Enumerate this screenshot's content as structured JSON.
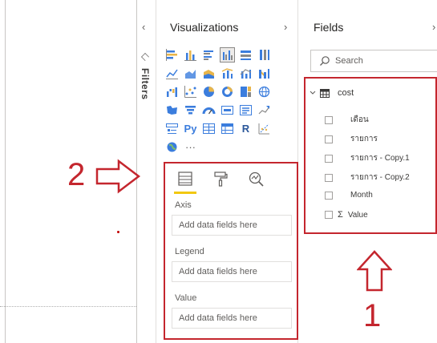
{
  "filters": {
    "label": "Filters"
  },
  "visualizations": {
    "title": "Visualizations",
    "visual_icons": [
      "stacked-bar-icon",
      "stacked-column-icon",
      "clustered-bar-icon",
      "clustered-column-icon",
      "100-stacked-bar-icon",
      "100-stacked-column-icon",
      "line-chart-icon",
      "area-chart-icon",
      "stacked-area-icon",
      "line-clustered-column-icon",
      "line-stacked-column-icon",
      "ribbon-chart-icon",
      "waterfall-icon",
      "scatter-icon",
      "pie-chart-icon",
      "donut-chart-icon",
      "treemap-icon",
      "map-icon",
      "filled-map-icon",
      "funnel-icon",
      "gauge-icon",
      "card-icon",
      "multi-row-card-icon",
      "kpi-icon",
      "slicer-icon",
      "python-visual-icon",
      "table-icon",
      "matrix-icon",
      "r-visual-icon",
      "key-influencers-icon",
      "globe-icon",
      "more-visuals-icon"
    ],
    "python_label": "Py",
    "r_label": "R",
    "more_label": "···",
    "wells": [
      {
        "label": "Axis",
        "placeholder": "Add data fields here"
      },
      {
        "label": "Legend",
        "placeholder": "Add data fields here"
      },
      {
        "label": "Value",
        "placeholder": "Add data fields here"
      }
    ]
  },
  "fields": {
    "title": "Fields",
    "search_placeholder": "Search",
    "table_name": "cost",
    "items": [
      {
        "label": "เดือน",
        "sigma": false
      },
      {
        "label": "รายการ",
        "sigma": false
      },
      {
        "label": "รายการ - Copy.1",
        "sigma": false
      },
      {
        "label": "รายการ - Copy.2",
        "sigma": false
      },
      {
        "label": "Month",
        "sigma": false
      },
      {
        "label": "Value",
        "sigma": true,
        "sigma_symbol": "Σ"
      }
    ]
  },
  "annotations": {
    "one": "1",
    "two": "2"
  },
  "colors": {
    "annotation_red": "#c4262e",
    "accent_yellow": "#f2c811",
    "accent_blue": "#3b7ddd"
  }
}
